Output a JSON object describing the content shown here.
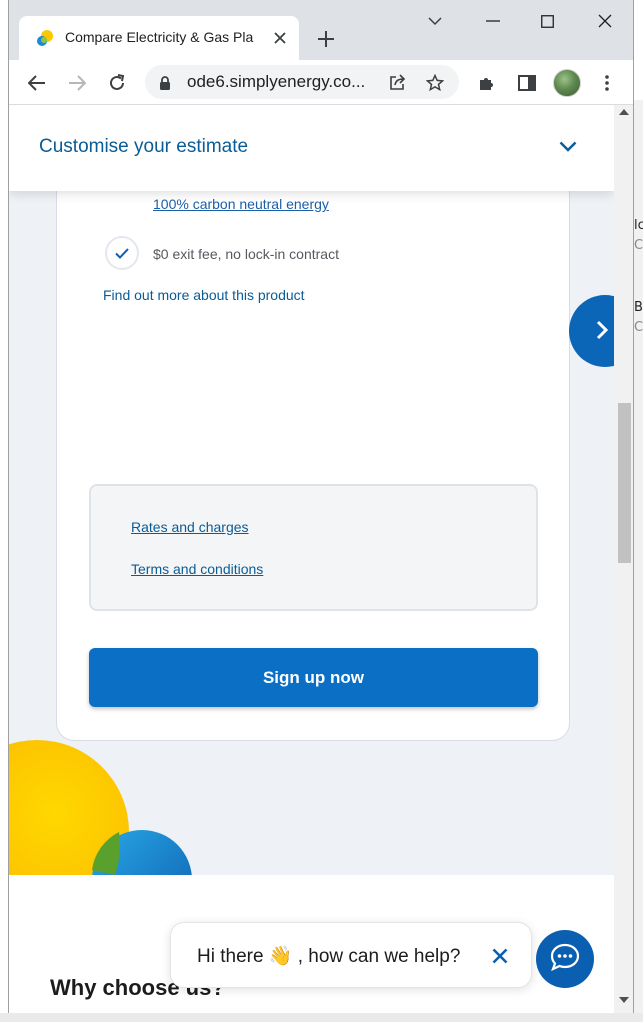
{
  "browser": {
    "tab_title": "Compare Electricity & Gas Pla",
    "url": "ode6.simplyenergy.co...",
    "icons": {
      "back": "arrow-left-icon",
      "forward": "arrow-right-icon",
      "reload": "reload-icon",
      "share": "share-icon",
      "bookmark": "star-icon",
      "extensions": "puzzle-icon",
      "side_panel": "side-panel-icon",
      "menu": "kebab-menu-icon"
    }
  },
  "desktop_fragments": [
    "lc",
    "C",
    "B:",
    "C"
  ],
  "page": {
    "sticky_header": {
      "title": "Customise your estimate"
    },
    "features": [
      {
        "label": "100% carbon neutral energy",
        "is_link": true
      },
      {
        "label": "$0 exit fee, no lock-in contract",
        "is_link": false
      }
    ],
    "find_out_more": "Find out more about this product",
    "documents": [
      {
        "label": "Rates and charges"
      },
      {
        "label": "Terms and conditions"
      }
    ],
    "signup_button": "Sign up now",
    "why_choose": "Why choose us?"
  },
  "chat": {
    "greeting": "Hi there 👋 , how can we help?"
  },
  "colors": {
    "brand_blue": "#0b70c5",
    "heading_blue": "#0a5c96",
    "accent_green": "#8dc63f",
    "sun_yellow": "#fcc800"
  }
}
